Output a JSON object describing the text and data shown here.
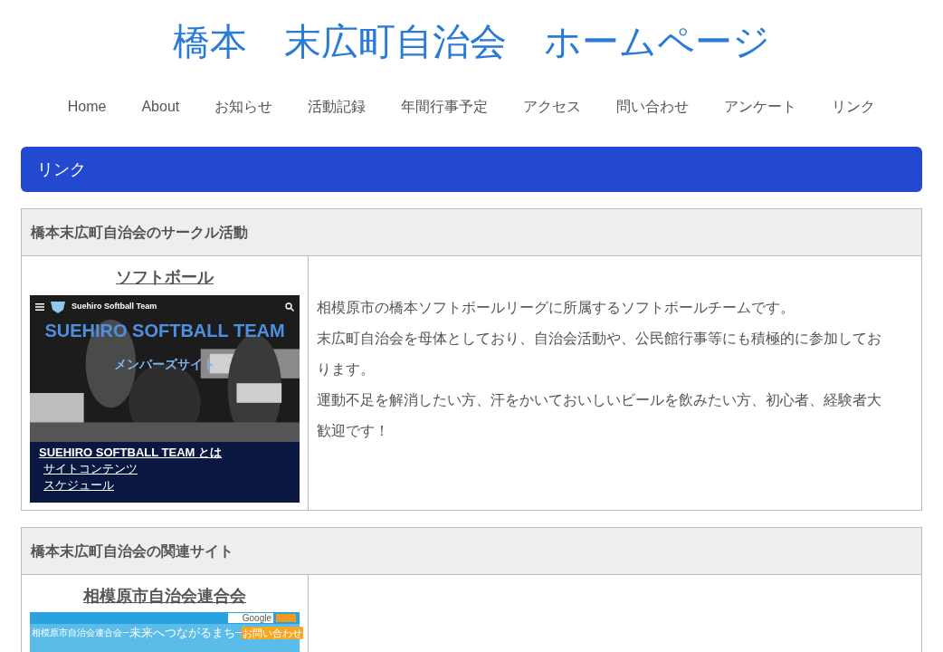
{
  "site_title": "橋本　末広町自治会　ホームページ",
  "nav": [
    {
      "label": "Home",
      "selected": false
    },
    {
      "label": "About",
      "selected": false
    },
    {
      "label": "お知らせ",
      "selected": false
    },
    {
      "label": "活動記録",
      "selected": false
    },
    {
      "label": "年間行事予定",
      "selected": false
    },
    {
      "label": "アクセス",
      "selected": false
    },
    {
      "label": "問い合わせ",
      "selected": false
    },
    {
      "label": "アンケート",
      "selected": false
    },
    {
      "label": "リンク",
      "selected": false
    }
  ],
  "page_heading": "リンク",
  "sections": [
    {
      "heading": "橋本末広町自治会のサークル活動",
      "entries": [
        {
          "kind": "softball",
          "title": "ソフトボール",
          "preview": {
            "header_title": "Suehiro Softball Team",
            "hero_title": "SUEHIRO SOFTBALL TEAM",
            "hero_subtitle": "メンバーズサイト",
            "links": [
              "SUEHIRO SOFTBALL TEAM とは",
              "サイトコンテンツ",
              "スケジュール"
            ]
          },
          "description": [
            "相模原市の橋本ソフトボールリーグに所属するソフトボールチームです。",
            "末広町自治会を母体としており、自治会活動や、公民館行事等にも積極的に参加しております。",
            "運動不足を解消したい方、汗をかいておいしいビールを飲みたい方、初心者、経験者大歓迎です！"
          ]
        }
      ]
    },
    {
      "heading": "橋本末広町自治会の関連サイト",
      "entries": [
        {
          "kind": "federation",
          "title": "相模原市自治会連合会",
          "preview": {
            "search_button": "Google",
            "hero_title": "相模原市自治会連合会",
            "hero_subtitle": "−未来へつながるまち−",
            "contact_button": "お問い合わせ"
          }
        }
      ]
    }
  ]
}
